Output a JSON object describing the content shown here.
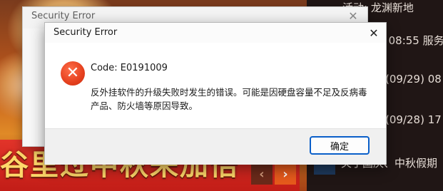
{
  "background": {
    "banner_text": "谷里过中秋来加倍",
    "nav_prev": "‹",
    "nav_next": "›",
    "news": [
      {
        "text": "活动: 龙渊新地"
      },
      {
        "text": ") 08:55 服务"
      },
      {
        "text": "(09/29) 08"
      },
      {
        "text": "(09/28) 17"
      },
      {
        "text": "关于国庆、中秋假期"
      }
    ]
  },
  "back_dialog": {
    "title": "Security Error",
    "close_glyph": "✕"
  },
  "dialog": {
    "title": "Security Error",
    "close_glyph": "✕",
    "icon_glyph": "✕",
    "code": "Code: E0191009",
    "message": "反外挂软件的升级失败时发生的错误。可能是因硬盘容量不足及反病毒产品、防火墙等原因导致。",
    "ok_label": "确定"
  },
  "colors": {
    "accent": "#0a5fc9",
    "error_icon": "#e5401e"
  }
}
